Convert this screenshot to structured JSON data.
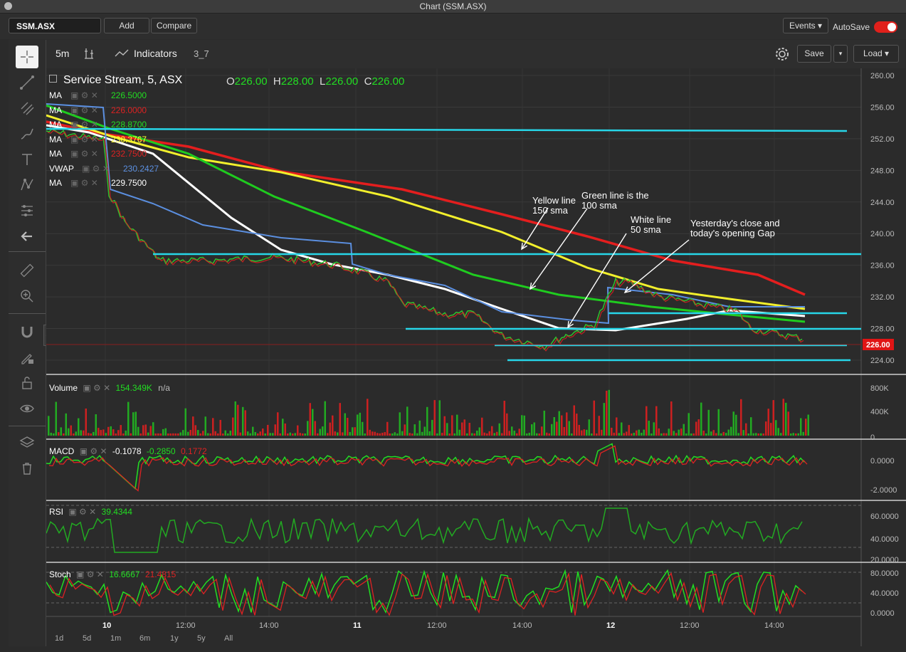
{
  "window": {
    "title": "Chart (SSM.ASX)"
  },
  "toolbar": {
    "symbol": "SSM.ASX",
    "add_label": "Add",
    "compare_label": "Compare",
    "events_label": "Events ▾",
    "autosave_label": "AutoSave",
    "autosave_on": true
  },
  "chart_header": {
    "interval": "5m",
    "indicators_label": "Indicators",
    "layout_name": "3_7",
    "save_label": "Save",
    "load_label": "Load ▾"
  },
  "legend": {
    "title": "Service Stream, 5, ASX",
    "open_label": "O",
    "open": "226.00",
    "high_label": "H",
    "high": "228.00",
    "low_label": "L",
    "low": "226.00",
    "close_label": "C",
    "close": "226.00",
    "studies": [
      {
        "name": "MA",
        "value": "226.5000",
        "color": "#22dd22"
      },
      {
        "name": "MA",
        "value": "226.0000",
        "color": "#dd2222"
      },
      {
        "name": "MA",
        "value": "228.8700",
        "color": "#22dd22"
      },
      {
        "name": "MA",
        "value": "230.3767",
        "color": "#ffff33"
      },
      {
        "name": "MA",
        "value": "232.7500",
        "color": "#dd2222"
      },
      {
        "name": "VWAP",
        "value": "230.2427",
        "color": "#5b8fe0"
      },
      {
        "name": "MA",
        "value": "229.7500",
        "color": "#ffffff"
      }
    ]
  },
  "annotations": [
    {
      "line1": "Yellow line",
      "line2": "150 sma"
    },
    {
      "line1": "Green line is the",
      "line2": "100 sma"
    },
    {
      "line1": "White line",
      "line2": "50 sma"
    },
    {
      "line1": "Yesterday's close and",
      "line2": "today's opening Gap"
    }
  ],
  "price_axis": {
    "ticks": [
      "260.00",
      "256.00",
      "252.00",
      "248.00",
      "244.00",
      "240.00",
      "236.00",
      "232.00",
      "228.00",
      "224.00"
    ],
    "last_price": "226.00"
  },
  "panels": {
    "volume": {
      "label": "Volume",
      "value": "154.349K",
      "value2": "n/a",
      "ticks": [
        "800K",
        "400K",
        "0"
      ]
    },
    "macd": {
      "label": "MACD",
      "v1": "-0.1078",
      "v2": "-0.2850",
      "v3": "0.1772",
      "ticks": [
        "0.0000",
        "-2.0000"
      ]
    },
    "rsi": {
      "label": "RSI",
      "value": "39.4344",
      "ticks": [
        "60.0000",
        "40.0000",
        "20.0000"
      ]
    },
    "stoch": {
      "label": "Stoch",
      "v1": "16.6667",
      "v2": "21.4815",
      "ticks": [
        "80.0000",
        "40.0000",
        "0.0000"
      ]
    }
  },
  "time_axis": {
    "labels": [
      "10",
      "12:00",
      "14:00",
      "11",
      "12:00",
      "14:00",
      "12",
      "12:00",
      "14:00"
    ]
  },
  "ranges": [
    "1d",
    "5d",
    "1m",
    "6m",
    "1y",
    "5y",
    "All"
  ],
  "colors": {
    "accent_cyan": "#27d6e8",
    "ma_red": "#e41e1e",
    "ma_yellow": "#f2ef2c",
    "ma_green": "#1fcc1f",
    "ma_white": "#ffffff",
    "vwap": "#5b8fe0"
  }
}
